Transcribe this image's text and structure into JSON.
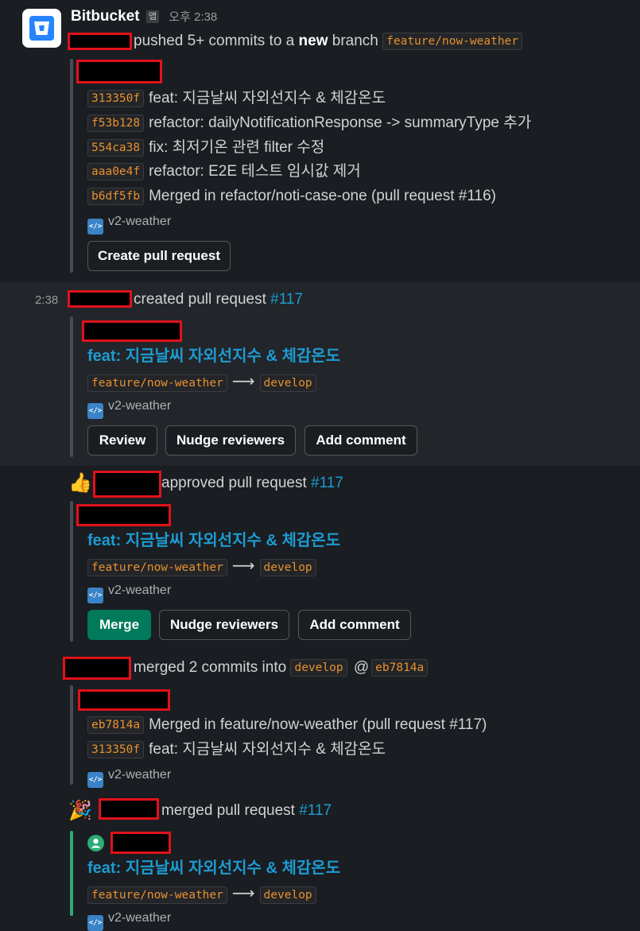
{
  "header": {
    "app_name": "Bitbucket",
    "app_badge": "앱",
    "time": "오후 2:38"
  },
  "push": {
    "text": "pushed 5+ commits to a ",
    "bold": "new",
    "text2": " branch ",
    "branch": "feature/now-weather",
    "commits": [
      {
        "hash": "313350f",
        "message": "feat: 지금날씨 자외선지수 & 체감온도"
      },
      {
        "hash": "f53b128",
        "message": "refactor: dailyNotificationResponse -> summaryType 추가"
      },
      {
        "hash": "554ca38",
        "message": "fix: 최저기온 관련 filter 수정"
      },
      {
        "hash": "aaa0e4f",
        "message": "refactor: E2E 테스트 임시값 제거"
      },
      {
        "hash": "b6df5fb",
        "message": "Merged in refactor/noti-case-one (pull request #116)"
      }
    ],
    "repo": "v2-weather",
    "button": "Create pull request"
  },
  "created": {
    "time": "2:38",
    "text": "created pull request ",
    "pr": "#117",
    "title": "feat: 지금날씨 자외선지수 & 체감온도",
    "source_branch": "feature/now-weather",
    "target_branch": "develop",
    "repo": "v2-weather",
    "buttons": [
      "Review",
      "Nudge reviewers",
      "Add comment"
    ]
  },
  "approved": {
    "emoji": "👍",
    "text": "approved pull request ",
    "pr": "#117",
    "title": "feat: 지금날씨 자외선지수 & 체감온도",
    "source_branch": "feature/now-weather",
    "target_branch": "develop",
    "repo": "v2-weather",
    "buttons": [
      "Merge",
      "Nudge reviewers",
      "Add comment"
    ]
  },
  "merged_commits": {
    "text": "merged 2 commits into ",
    "branch": "develop",
    "at": "@",
    "commit_ref": "eb7814a",
    "commits": [
      {
        "hash": "eb7814a",
        "message": "Merged in feature/now-weather (pull request #117)"
      },
      {
        "hash": "313350f",
        "message": "feat: 지금날씨 자외선지수 & 체감온도"
      }
    ],
    "repo": "v2-weather"
  },
  "merged_pr": {
    "emoji": "🎉",
    "text": "merged pull request ",
    "pr": "#117",
    "title": "feat: 지금날씨 자외선지수 & 체감온도",
    "source_branch": "feature/now-weather",
    "target_branch": "develop",
    "repo": "v2-weather"
  },
  "colors": {
    "accent_link": "#1d9bd1",
    "merge_button": "#007a5a",
    "code_text": "#e8912d",
    "redaction_border": "#e0121b"
  }
}
